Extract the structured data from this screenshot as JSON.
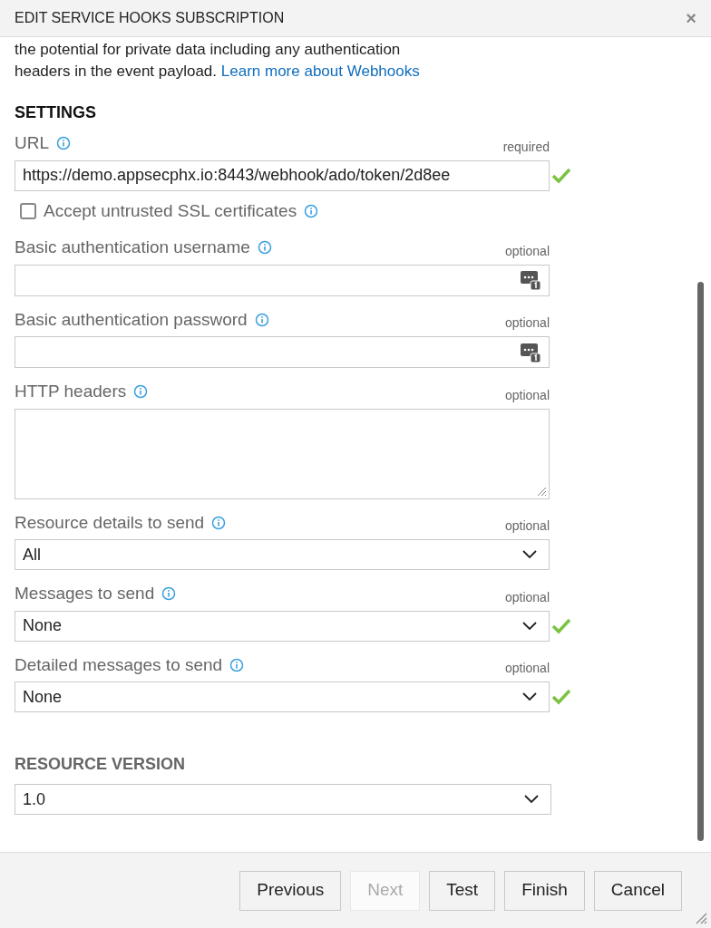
{
  "dialog": {
    "title": "EDIT SERVICE HOOKS SUBSCRIPTION",
    "close": "×"
  },
  "intro": {
    "lines": [
      "the potential for private data including any authentication",
      "headers in the event payload."
    ],
    "link": "Learn more about Webhooks"
  },
  "settings": {
    "heading": "SETTINGS",
    "fields": [
      {
        "kind": "text",
        "label": "URL",
        "note": "required",
        "value": "https://demo.appsecphx.io:8443/webhook/ado/token/2d8ee",
        "valid": true
      },
      {
        "kind": "checkbox",
        "label": "Accept untrusted SSL certificates",
        "checked": false
      },
      {
        "kind": "password",
        "label": "Basic authentication username",
        "note": "optional",
        "valid": false
      },
      {
        "kind": "password",
        "label": "Basic authentication password",
        "note": "optional",
        "valid": false
      },
      {
        "kind": "textarea",
        "label": "HTTP headers",
        "note": "optional",
        "valid": false
      },
      {
        "kind": "select",
        "label": "Resource details to send",
        "note": "optional",
        "value": "All",
        "valid": false
      },
      {
        "kind": "select",
        "label": "Messages to send",
        "note": "optional",
        "value": "None",
        "valid": true
      },
      {
        "kind": "select",
        "label": "Detailed messages to send",
        "note": "optional",
        "value": "None",
        "valid": true
      }
    ]
  },
  "resource_version": {
    "heading": "RESOURCE VERSION",
    "value": "1.0"
  },
  "buttons": [
    {
      "label": "Previous",
      "disabled": false
    },
    {
      "label": "Next",
      "disabled": true
    },
    {
      "label": "Test",
      "disabled": false
    },
    {
      "label": "Finish",
      "disabled": false
    },
    {
      "label": "Cancel",
      "disabled": false
    }
  ]
}
